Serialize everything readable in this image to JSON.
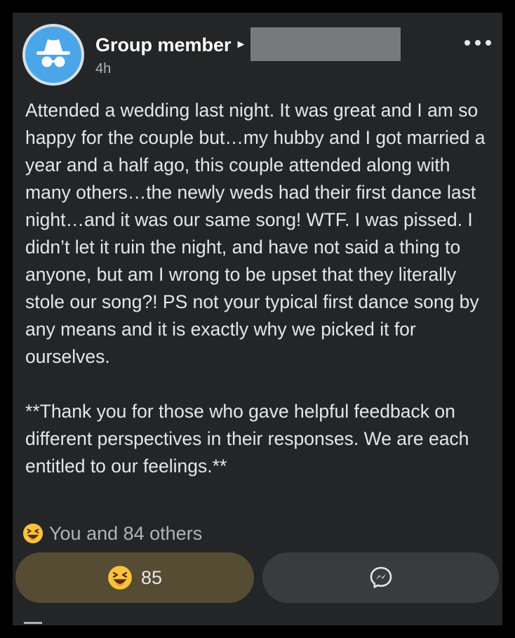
{
  "post": {
    "author": "Group member",
    "arrow_glyph": "►",
    "time": "4h",
    "text": "Attended a wedding last night. It was great and I am so happy for the couple but…my hubby and I got married a year and a half ago, this couple attended along with many others…the newly weds had their first dance last night…and it was our same song! WTF. I was pissed. I didn’t let it ruin the night, and have not said a thing to anyone, but am I wrong to be upset that they literally stole our song?! PS not your typical first dance song by any means and it is exactly why we picked it for ourselves.\n\n**Thank you for those who gave helpful feedback on different perspectives in their responses. We are each entitled to our feelings.**"
  },
  "reactions": {
    "summary": "You and 84 others",
    "count": "85",
    "icon": "laughing-face-icon"
  },
  "colors": {
    "card_bg": "#242526",
    "avatar_blue": "#4aa6e9",
    "reaction_button_bg": "#564c34",
    "message_button_bg": "#3a3b3c",
    "emoji_yellow": "#f7c33b"
  }
}
